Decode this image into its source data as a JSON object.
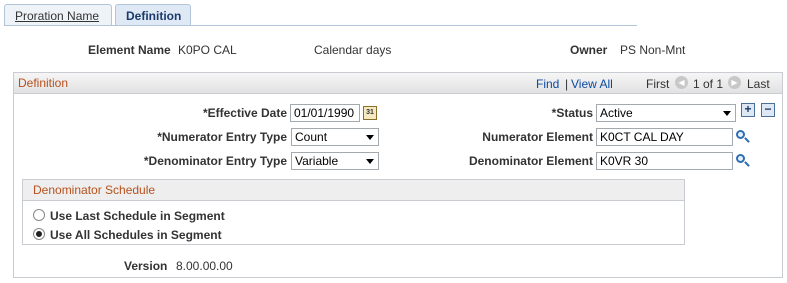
{
  "tabs": [
    {
      "label": "Proration Name",
      "active": false
    },
    {
      "label": "Definition",
      "active": true
    }
  ],
  "header": {
    "element_name_label": "Element Name",
    "element_name_value": "K0PO CAL",
    "description": "Calendar days",
    "owner_label": "Owner",
    "owner_value": "PS Non-Mnt"
  },
  "definition": {
    "title": "Definition",
    "nav": {
      "find": "Find",
      "sep": "|",
      "view_all": "View All",
      "first": "First",
      "count": "1 of 1",
      "last": "Last"
    },
    "effective_date_label": "*Effective Date",
    "effective_date_value": "01/01/1990",
    "status_label": "*Status",
    "status_value": "Active",
    "numerator_entry_label": "*Numerator Entry Type",
    "numerator_entry_value": "Count",
    "numerator_element_label": "Numerator Element",
    "numerator_element_value": "K0CT CAL DAY",
    "denominator_entry_label": "*Denominator Entry Type",
    "denominator_entry_value": "Variable",
    "denominator_element_label": "Denominator Element",
    "denominator_element_value": "K0VR 30"
  },
  "schedule": {
    "title": "Denominator Schedule",
    "option1": "Use Last Schedule in Segment",
    "option2": "Use All Schedules in Segment",
    "selected": "option2"
  },
  "version": {
    "label": "Version",
    "value": "8.00.00.00"
  },
  "icons": {
    "calendar": "calendar-icon",
    "lookup": "magnifier-icon",
    "add": "plus",
    "remove": "minus",
    "nav_prev": "left-arrow-circle",
    "nav_next": "right-arrow-circle"
  },
  "colors": {
    "section_title": "#b7501c",
    "link": "#0b4aa2",
    "active_tab": "#1a3a6b"
  }
}
